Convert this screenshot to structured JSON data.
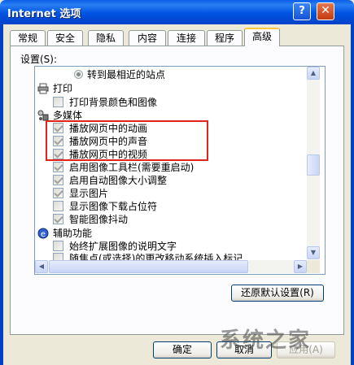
{
  "window": {
    "title": "Internet 选项",
    "help_label": "?",
    "close_label": "✕"
  },
  "tabs": [
    {
      "label": "常规"
    },
    {
      "label": "安全"
    },
    {
      "label": "隐私"
    },
    {
      "label": "内容"
    },
    {
      "label": "连接"
    },
    {
      "label": "程序"
    },
    {
      "label": "高级"
    }
  ],
  "settings": {
    "label": "设置(S):",
    "rows": [
      {
        "type": "radio",
        "label": "转到最相近的站点"
      },
      {
        "type": "category",
        "icon": "printer-icon",
        "label": "打印"
      },
      {
        "type": "check",
        "checked": false,
        "label": "打印背景颜色和图像"
      },
      {
        "type": "category",
        "icon": "multimedia-icon",
        "label": "多媒体"
      },
      {
        "type": "check",
        "checked": true,
        "label": "播放网页中的动画"
      },
      {
        "type": "check",
        "checked": true,
        "label": "播放网页中的声音"
      },
      {
        "type": "check",
        "checked": true,
        "label": "播放网页中的视频"
      },
      {
        "type": "check",
        "checked": true,
        "label": "启用图像工具栏(需要重启动)"
      },
      {
        "type": "check",
        "checked": true,
        "label": "启用自动图像大小调整"
      },
      {
        "type": "check",
        "checked": true,
        "label": "显示图片"
      },
      {
        "type": "check",
        "checked": false,
        "label": "显示图像下载占位符"
      },
      {
        "type": "check",
        "checked": true,
        "label": "智能图像抖动"
      },
      {
        "type": "category",
        "icon": "accessibility-icon",
        "label": "辅助功能"
      },
      {
        "type": "check",
        "checked": false,
        "label": "始终扩展图像的说明文字"
      },
      {
        "type": "check",
        "checked": false,
        "label": "随焦点(或选择)的更改移动系统插入标记"
      }
    ]
  },
  "buttons": {
    "restore": "还原默认设置(R)",
    "ok": "确定",
    "cancel": "取消",
    "apply": "应用(A)"
  },
  "watermark": "系统之家",
  "colors": {
    "highlight": "#E2231A",
    "titlebar": "#0053E1"
  }
}
